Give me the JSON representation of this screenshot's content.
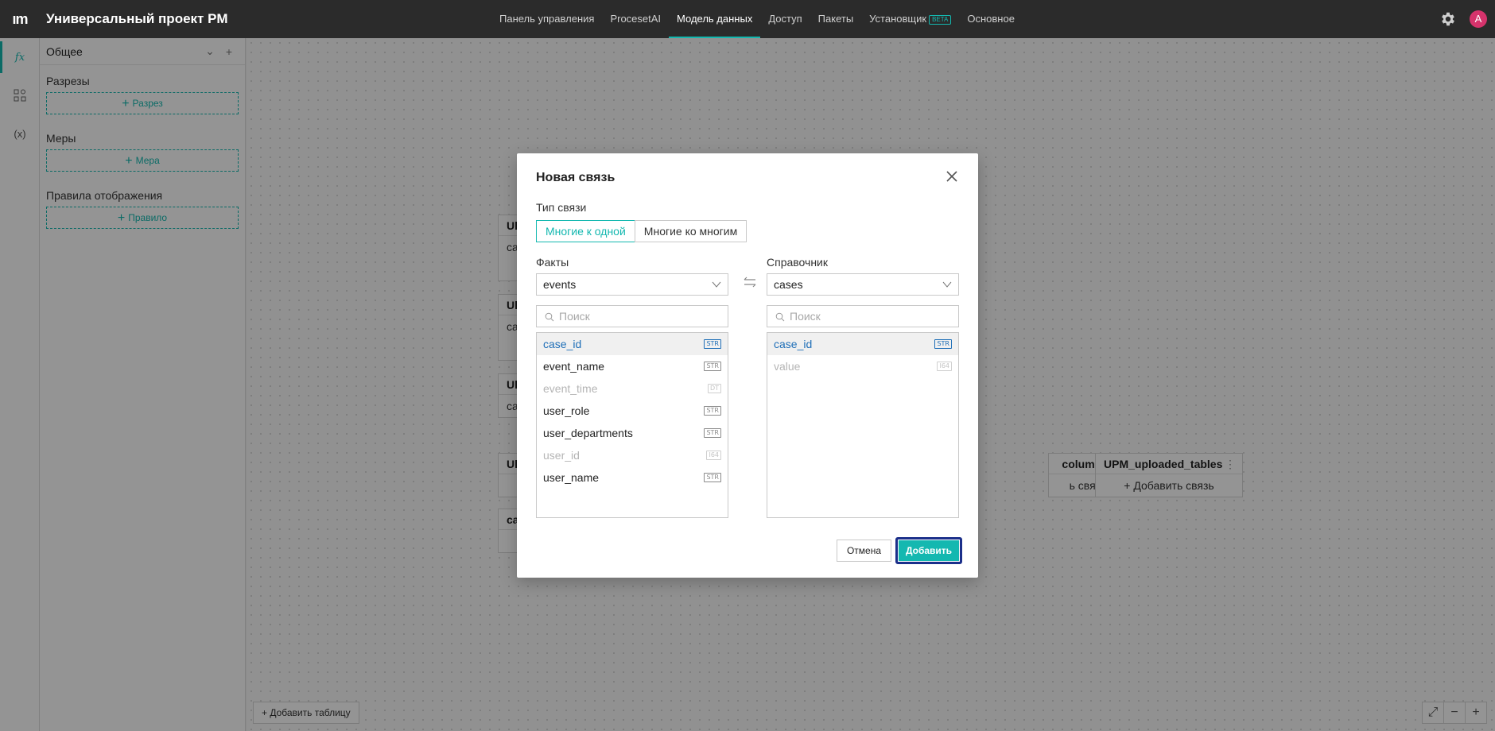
{
  "app": {
    "logo": "ım",
    "title": "Универсальный проект PM",
    "avatar_letter": "A"
  },
  "nav": [
    {
      "label": "Панель управления",
      "active": false
    },
    {
      "label": "ProcesetAI",
      "active": false
    },
    {
      "label": "Модель данных",
      "active": true
    },
    {
      "label": "Доступ",
      "active": false
    },
    {
      "label": "Пакеты",
      "active": false
    },
    {
      "label": "Установщик",
      "active": false,
      "badge": "BETA"
    },
    {
      "label": "Основное",
      "active": false
    }
  ],
  "rail": {
    "formula": "fx",
    "nodes": "",
    "variables": "(x)"
  },
  "panel": {
    "title": "Общее",
    "sections": [
      {
        "title": "Разрезы",
        "add_label": "Разрез"
      },
      {
        "title": "Меры",
        "add_label": "Мера"
      },
      {
        "title": "Правила отображения",
        "add_label": "Правило"
      }
    ]
  },
  "canvas": {
    "cards_left_fragments": [
      "Ul",
      "ca",
      "Ul",
      "ca",
      "Ul",
      "ca",
      "Ul",
      "ca"
    ],
    "card_columns": {
      "title": "columns",
      "add_label": "ь связь"
    },
    "card_uploaded": {
      "title": "UPM_uploaded_tables",
      "add_label": "Добавить связь"
    },
    "add_table_label": "Добавить таблицу"
  },
  "modal": {
    "title": "Новая связь",
    "relation_type_label": "Тип связи",
    "relation_types": [
      {
        "label": "Многие к одной",
        "active": true
      },
      {
        "label": "Многие ко многим",
        "active": false
      }
    ],
    "facts": {
      "label": "Факты",
      "selected_table": "events",
      "search_placeholder": "Поиск",
      "columns": [
        {
          "name": "case_id",
          "type": "STR",
          "state": "selected"
        },
        {
          "name": "event_name",
          "type": "STR",
          "state": "normal"
        },
        {
          "name": "event_time",
          "type": "DT",
          "state": "disabled"
        },
        {
          "name": "user_role",
          "type": "STR",
          "state": "normal"
        },
        {
          "name": "user_departments",
          "type": "STR",
          "state": "normal"
        },
        {
          "name": "user_id",
          "type": "I64",
          "state": "disabled"
        },
        {
          "name": "user_name",
          "type": "STR",
          "state": "normal"
        }
      ]
    },
    "reference": {
      "label": "Справочник",
      "selected_table": "cases",
      "search_placeholder": "Поиск",
      "columns": [
        {
          "name": "case_id",
          "type": "STR",
          "state": "selected"
        },
        {
          "name": "value",
          "type": "I64",
          "state": "disabled"
        }
      ]
    },
    "cancel_label": "Отмена",
    "add_label": "Добавить"
  },
  "colors": {
    "accent": "#14b8b0",
    "topbar": "#2b2b2b",
    "selected_text": "#1f6fb8",
    "focus_ring": "#1b2f8a"
  }
}
